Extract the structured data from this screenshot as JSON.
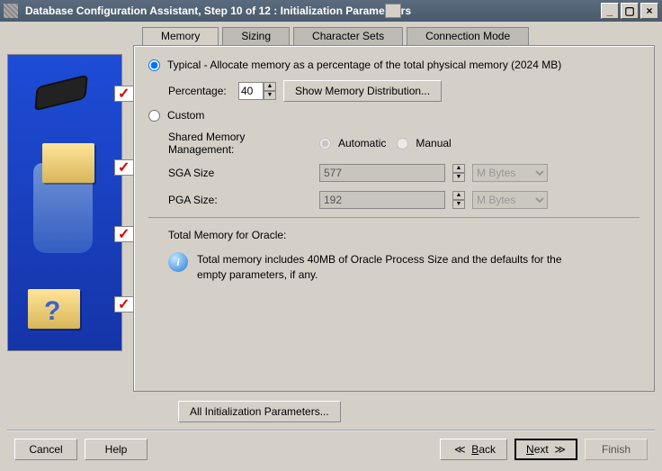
{
  "window": {
    "title_prefix": "Database Configuration Assistant, Step 10 of 12 : Initialization Parame",
    "title_suffix": "rs"
  },
  "tabs": {
    "memory": "Memory",
    "sizing": "Sizing",
    "charsets": "Character Sets",
    "connmode": "Connection Mode"
  },
  "memory": {
    "typical_label": "Typical - Allocate memory as a percentage of the total physical memory (2024 MB)",
    "percentage_label": "Percentage:",
    "percentage_value": "40",
    "show_dist_button": "Show Memory Distribution...",
    "custom_label": "Custom",
    "shared_mgmt_label": "Shared Memory Management:",
    "auto_label": "Automatic",
    "manual_label": "Manual",
    "sga_label": "SGA Size",
    "sga_value": "577",
    "pga_label": "PGA Size:",
    "pga_value": "192",
    "units": "M Bytes",
    "total_label": "Total Memory for Oracle:",
    "info_text": "Total memory includes 40MB of Oracle Process Size and the defaults for the empty parameters, if any."
  },
  "buttons": {
    "all_params": "All Initialization Parameters...",
    "cancel": "Cancel",
    "help": "Help",
    "back": "Back",
    "next": "Next",
    "finish": "Finish"
  }
}
